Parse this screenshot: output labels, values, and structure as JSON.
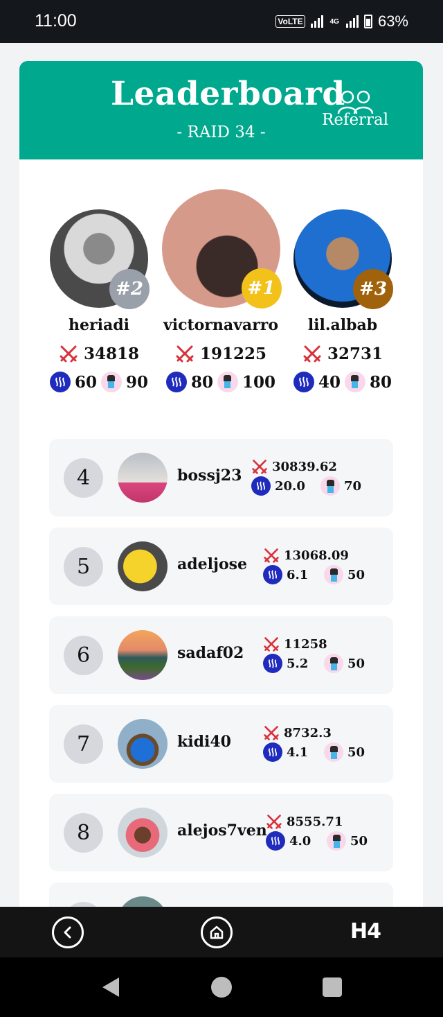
{
  "status": {
    "time": "11:00",
    "volte": "VoLTE",
    "network": "4G",
    "battery": "63%"
  },
  "header": {
    "title": "Leaderboard",
    "subtitle": "- RAID 34 -",
    "referral_label": "Referral"
  },
  "podium": [
    {
      "rank_label": "#2",
      "name": "heriadi",
      "score": "34818",
      "steem": "60",
      "token": "90",
      "badge_color": "#9aa0aa"
    },
    {
      "rank_label": "#1",
      "name": "victornavarro",
      "score": "191225",
      "steem": "80",
      "token": "100",
      "badge_color": "#f3c21a"
    },
    {
      "rank_label": "#3",
      "name": "lil.albab",
      "score": "32731",
      "steem": "40",
      "token": "80",
      "badge_color": "#a0620b"
    }
  ],
  "rankings": [
    {
      "rank": "4",
      "name": "bossj23",
      "score": "30839.62",
      "steem": "20.0",
      "token": "70"
    },
    {
      "rank": "5",
      "name": "adeljose",
      "score": "13068.09",
      "steem": "6.1",
      "token": "50"
    },
    {
      "rank": "6",
      "name": "sadaf02",
      "score": "11258",
      "steem": "5.2",
      "token": "50"
    },
    {
      "rank": "7",
      "name": "kidi40",
      "score": "8732.3",
      "steem": "4.1",
      "token": "50"
    },
    {
      "rank": "8",
      "name": "alejos7ven",
      "score": "8555.71",
      "steem": "4.0",
      "token": "50"
    }
  ],
  "nav": {
    "back_icon": "back-circle-icon",
    "home_icon": "home-icon",
    "brand": "H4"
  },
  "colors": {
    "header": "#00a88e",
    "steem": "#1f2bbd",
    "swords": "#d8323c"
  }
}
